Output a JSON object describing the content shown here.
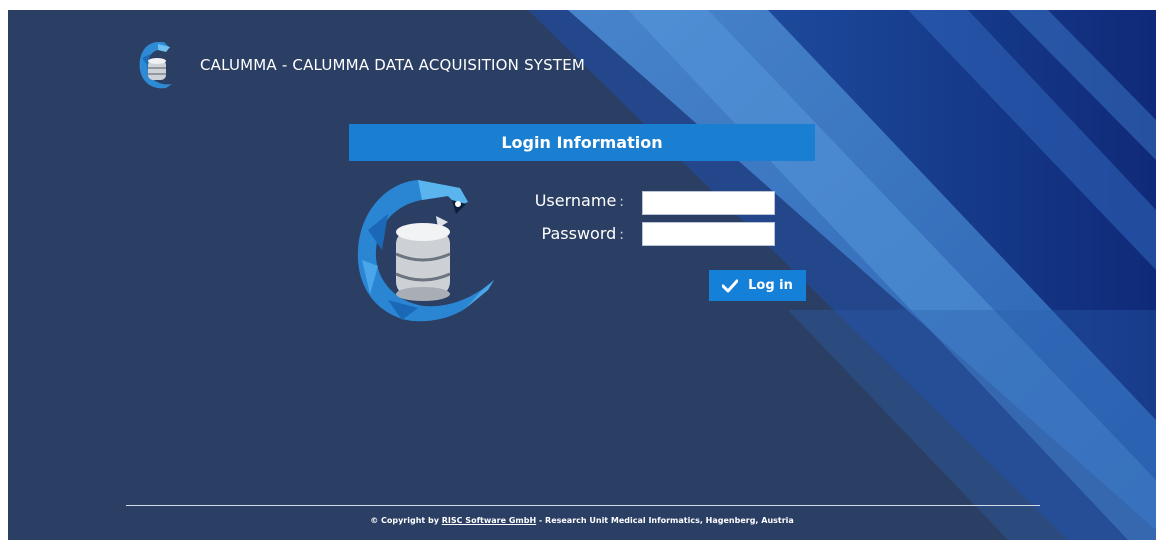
{
  "header": {
    "title": "CALUMMA - CALUMMA DATA ACQUISITION SYSTEM",
    "logo_icon": "calumma-chameleon-database-logo"
  },
  "login": {
    "title": "Login Information",
    "username_label": "Username",
    "password_label": "Password",
    "label_separator": ":",
    "username_value": "",
    "password_value": "",
    "submit_label": "Log in",
    "submit_icon": "check-icon"
  },
  "footer": {
    "copyright_prefix": "© Copyright by",
    "company_link": "RISC Software GmbH",
    "copyright_suffix": " - Research Unit Medical Informatics, Hagenberg, Austria"
  },
  "colors": {
    "background": "#2b3f64",
    "accent": "#1a7fd0",
    "stripe_light": "#3a7dc6",
    "stripe_dark": "#122e7e"
  }
}
